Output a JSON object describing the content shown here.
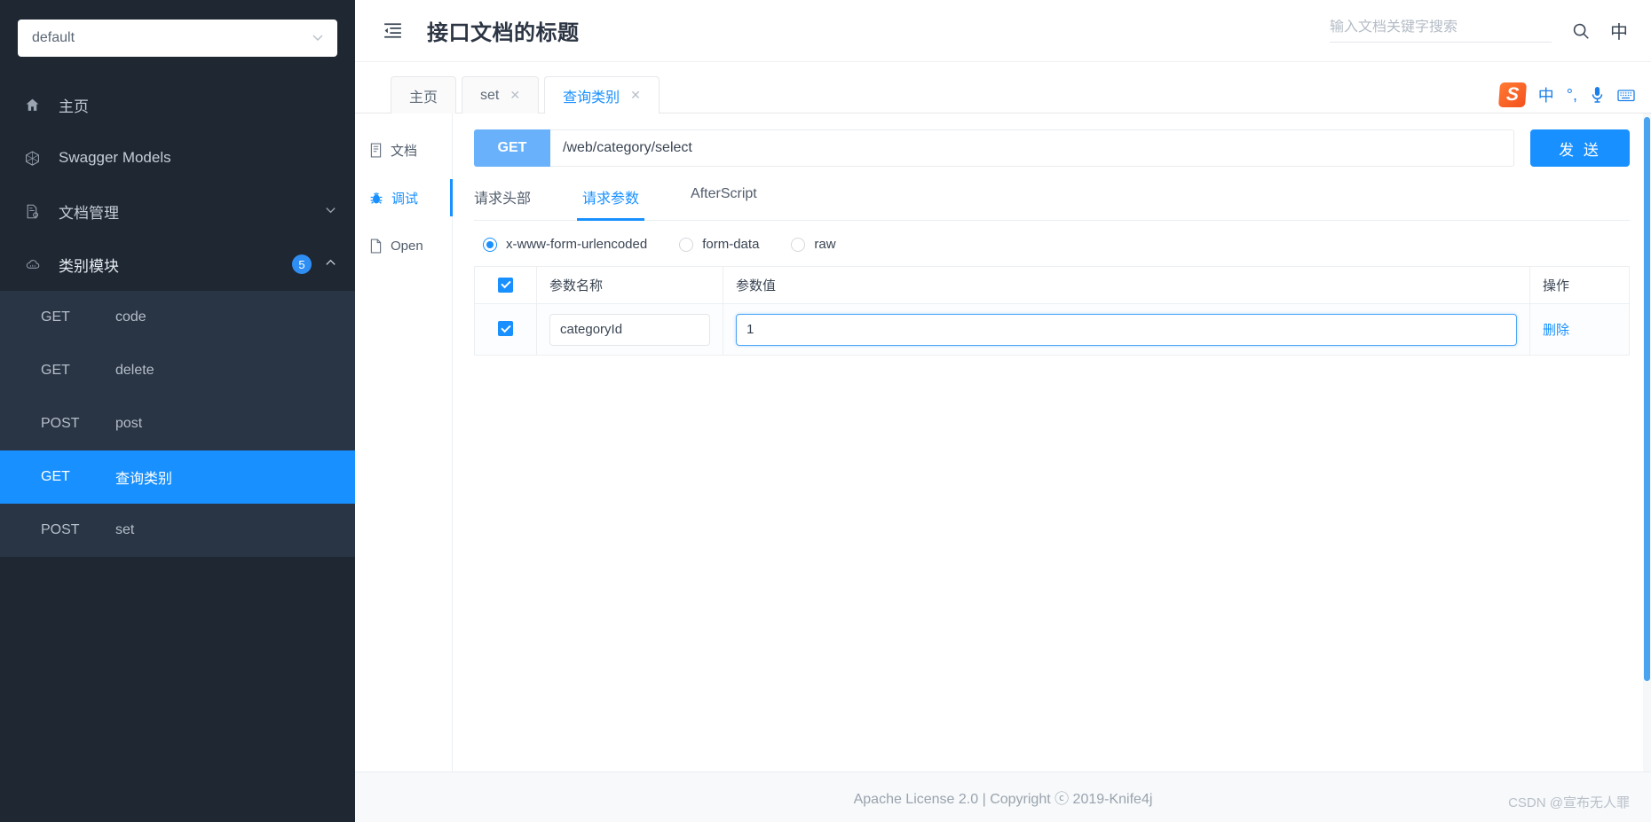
{
  "sidebar": {
    "select_value": "default",
    "select_icon": "chevron-down-icon",
    "items": [
      {
        "label": "主页",
        "icon": "home-icon"
      },
      {
        "label": "Swagger Models",
        "icon": "models-icon"
      },
      {
        "label": "文档管理",
        "icon": "document-settings-icon",
        "caret": "chevron-down-icon"
      },
      {
        "label": "类别模块",
        "icon": "cloud-icon",
        "badge": "5",
        "caret": "chevron-up-icon"
      }
    ],
    "submenu": [
      {
        "method": "GET",
        "name": "code",
        "active": false
      },
      {
        "method": "GET",
        "name": "delete",
        "active": false
      },
      {
        "method": "POST",
        "name": "post",
        "active": false
      },
      {
        "method": "GET",
        "name": "查询类别",
        "active": true
      },
      {
        "method": "POST",
        "name": "set",
        "active": false
      }
    ]
  },
  "topbar": {
    "collapse_icon": "menu-fold-icon",
    "title": "接口文档的标题",
    "search_placeholder": "输入文档关键字搜索",
    "search_value": "",
    "search_icon": "search-icon",
    "lang_label": "中"
  },
  "tabstrip": {
    "tabs": [
      {
        "label": "主页",
        "closable": false,
        "active": false
      },
      {
        "label": "set",
        "closable": true,
        "active": false
      },
      {
        "label": "查询类别",
        "closable": true,
        "active": true
      }
    ],
    "close_glyph": "✕",
    "ime": {
      "logo": "S",
      "items": [
        {
          "label": "中",
          "name": "ime-chinese-mode-icon"
        },
        {
          "label": "°,",
          "name": "ime-punctuation-icon"
        },
        {
          "label": "🎤",
          "name": "ime-microphone-icon"
        },
        {
          "label": "⌨",
          "name": "ime-keyboard-icon"
        }
      ]
    }
  },
  "vtabs": [
    {
      "label": "文档",
      "icon": "document-icon",
      "active": false
    },
    {
      "label": "调试",
      "icon": "bug-icon",
      "active": true
    },
    {
      "label": "Open",
      "icon": "file-icon",
      "active": false
    }
  ],
  "request": {
    "method": "GET",
    "url": "/web/category/select",
    "send_label": "发 送",
    "subtabs": [
      {
        "label": "请求头部",
        "active": false
      },
      {
        "label": "请求参数",
        "active": true
      },
      {
        "label": "AfterScript",
        "active": false
      }
    ],
    "body_types": [
      {
        "label": "x-www-form-urlencoded",
        "checked": true
      },
      {
        "label": "form-data",
        "checked": false
      },
      {
        "label": "raw",
        "checked": false
      }
    ],
    "table": {
      "headers": [
        "",
        "参数名称",
        "参数值",
        "操作"
      ],
      "rows": [
        {
          "checked": true,
          "name": "categoryId",
          "value": "1",
          "action": "删除"
        }
      ]
    }
  },
  "footer": {
    "text": "Apache License 2.0 | Copyright ⓒ 2019-Knife4j",
    "watermark": "CSDN @宣布无人罪"
  },
  "colors": {
    "accent": "#1890ff",
    "sidebar_bg": "#1f2733",
    "submenu_bg": "#293444",
    "method_get": "#69b1fb"
  }
}
